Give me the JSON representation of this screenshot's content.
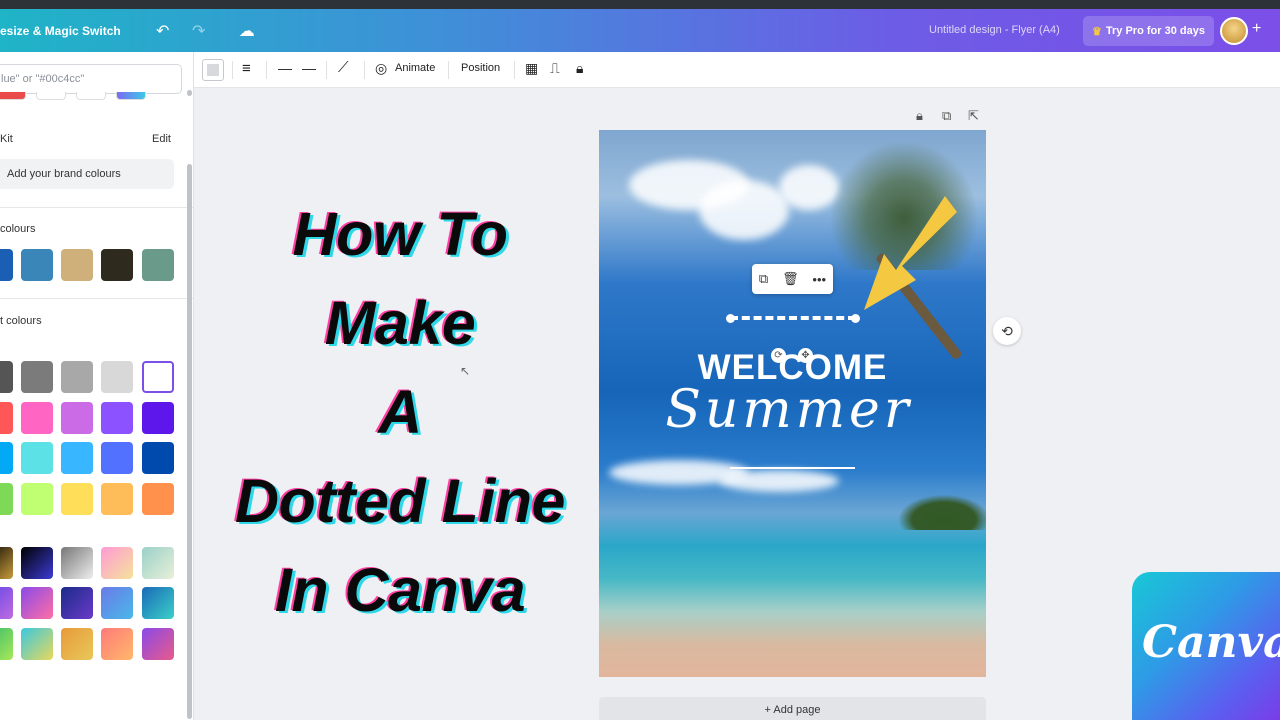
{
  "topbar": {
    "resize_label": "esize & Magic Switch",
    "undo_icon": "undo-icon",
    "redo_icon": "redo-icon",
    "cloud_icon": "cloud-save-icon",
    "design_title": "Untitled design - Flyer (A4)",
    "pro_label": "Try Pro for 30 days",
    "pro_icon": "crown-icon",
    "plus_label": "+"
  },
  "panel": {
    "search_placeholder": "lue\" or \"#00c4cc\"",
    "brand_kit_label": "Kit",
    "edit_label": "Edit",
    "brand_button": "Add your brand colours",
    "doc_colours_label": "colours",
    "default_colours_label": "t colours",
    "doc_swatches": [
      "#1a5fb4",
      "#3a86b8",
      "#d0b07a",
      "#2e2b1e",
      "#6a9a8a"
    ]
  },
  "toolbar": {
    "animate_label": "Animate",
    "position_label": "Position"
  },
  "overlay_title": [
    "How To",
    "Make",
    "A",
    "Dotted Line",
    "In Canva"
  ],
  "design": {
    "welcome": "WELCOME",
    "summer": "Summer"
  },
  "selection_menu": {
    "copy_icon": "copy-icon",
    "delete_icon": "trash-icon",
    "more_icon": "more-icon"
  },
  "add_page_label": "+ Add page",
  "logo_text": "Canva",
  "colors": {
    "accent_arrow": "#f5c842",
    "topbar_start": "#1fb4c7",
    "topbar_end": "#7b4fe8"
  }
}
